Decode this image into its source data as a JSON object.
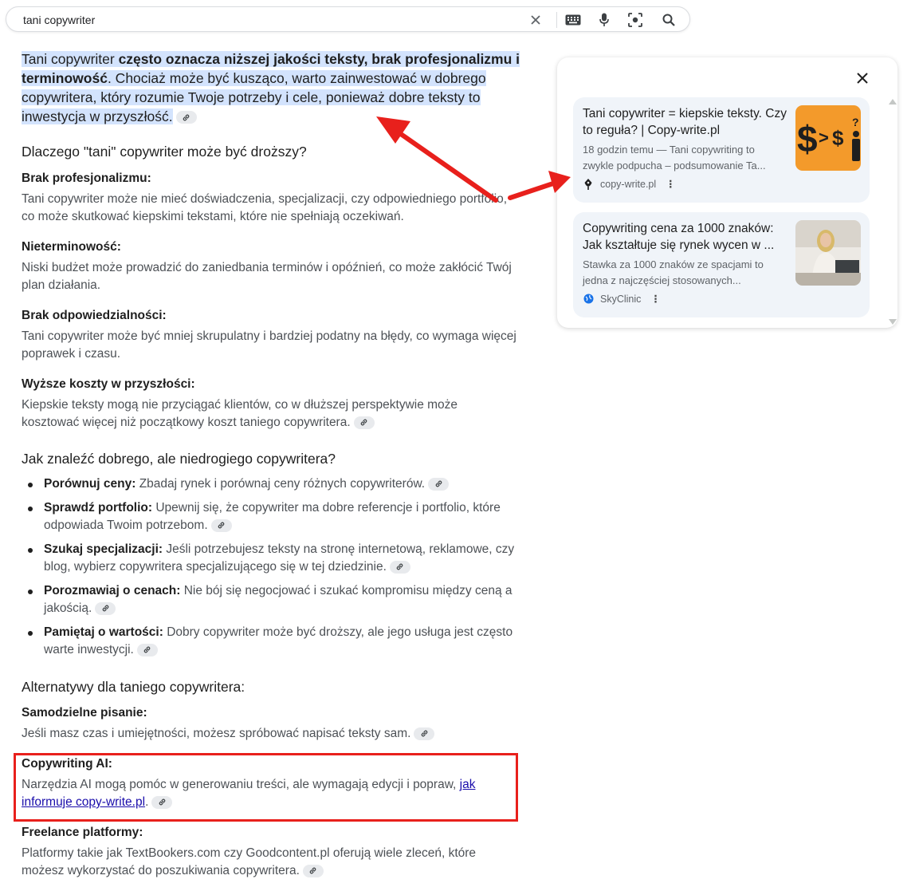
{
  "search": {
    "query": "tani copywriter",
    "icons": [
      "close-icon",
      "keyboard-icon",
      "mic-icon",
      "lens-icon",
      "search-icon"
    ]
  },
  "answer": {
    "intro_start": "Tani copywriter ",
    "intro_bold": "często oznacza niższej jakości teksty, brak profesjonalizmu i terminowość",
    "intro_rest": ". Chociaż może być kusząco, warto zainwestować w dobrego copywritera, który rozumie Twoje potrzeby i cele, ponieważ dobre teksty to inwestycja w przyszłość.",
    "heading_why": "Dlaczego \"tani\" copywriter może być droższy?",
    "reasons": [
      {
        "title": "Brak profesjonalizmu:",
        "text": "Tani copywriter może nie mieć doświadczenia, specjalizacji, czy odpowiedniego portfolio, co może skutkować kiepskimi tekstami, które nie spełniają oczekiwań."
      },
      {
        "title": "Nieterminowość:",
        "text": "Niski budżet może prowadzić do zaniedbania terminów i opóźnień, co może zakłócić Twój plan działania."
      },
      {
        "title": "Brak odpowiedzialności:",
        "text": "Tani copywriter może być mniej skrupulatny i bardziej podatny na błędy, co wymaga więcej poprawek i czasu."
      },
      {
        "title": "Wyższe koszty w przyszłości:",
        "text": "Kiepskie teksty mogą nie przyciągać klientów, co w dłuższej perspektywie może kosztować więcej niż początkowy koszt taniego copywritera."
      }
    ],
    "heading_find": "Jak znaleźć dobrego, ale niedrogiego copywritera?",
    "tips": [
      {
        "title": "Porównuj ceny:",
        "text": " Zbadaj rynek i porównaj ceny różnych copywriterów."
      },
      {
        "title": "Sprawdź portfolio:",
        "text": " Upewnij się, że copywriter ma dobre referencje i portfolio, które odpowiada Twoim potrzebom."
      },
      {
        "title": "Szukaj specjalizacji:",
        "text": " Jeśli potrzebujesz teksty na stronę internetową, reklamowe, czy blog, wybierz copywritera specjalizującego się w tej dziedzinie."
      },
      {
        "title": "Porozmawiaj o cenach:",
        "text": " Nie bój się negocjować i szukać kompromisu między ceną a jakością."
      },
      {
        "title": "Pamiętaj o wartości:",
        "text": " Dobry copywriter może być droższy, ale jego usługa jest często warte inwestycji."
      }
    ],
    "heading_alt": "Alternatywy dla taniego copywritera:",
    "alternatives": [
      {
        "title": "Samodzielne pisanie:",
        "text": "Jeśli masz czas i umiejętności, możesz spróbować napisać teksty sam."
      },
      {
        "title": "Copywriting AI:",
        "text": "Narzędzia AI mogą pomóc w generowaniu treści, ale wymagają edycji i popraw, ",
        "link": "jak informuje copy-write.pl",
        "after": "."
      },
      {
        "title": "Freelance platformy:",
        "text": "Platformy takie jak TextBookers.com czy Goodcontent.pl oferują wiele zleceń, które możesz wykorzystać do poszukiwania copywritera."
      }
    ]
  },
  "sources": [
    {
      "title": "Tani copywriter = kiepskie teksty. Czy to reguła? | Copy-write.pl",
      "snippet": "18 godzin temu — Tani copywriting to zwykle podpucha – podsumowanie Ta...",
      "site": "copy-write.pl",
      "thumb_text": "$>$?"
    },
    {
      "title": "Copywriting cena za 1000 znaków: Jak kształtuje się rynek wycen w ...",
      "snippet": "Stawka za 1000 znaków ze spacjami to jedna z najczęściej stosowanych...",
      "site": "SkyClinic"
    }
  ],
  "colors": {
    "highlight": "#d3e3fd",
    "annotation_red": "#e8201c",
    "link": "#1a0dab",
    "thumb_orange": "#f39a2b"
  }
}
